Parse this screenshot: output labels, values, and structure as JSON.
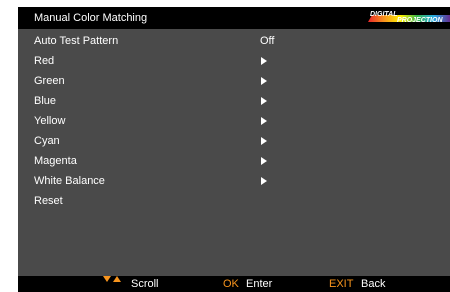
{
  "header": {
    "title": "Manual Color Matching",
    "logo_text": [
      "DIGITAL",
      "PROJECTION"
    ]
  },
  "menu": {
    "items": [
      {
        "label": "Auto Test Pattern",
        "value": "Off"
      },
      {
        "label": "Red",
        "has_submenu": true
      },
      {
        "label": "Green",
        "has_submenu": true
      },
      {
        "label": "Blue",
        "has_submenu": true
      },
      {
        "label": "Yellow",
        "has_submenu": true
      },
      {
        "label": "Cyan",
        "has_submenu": true
      },
      {
        "label": "Magenta",
        "has_submenu": true
      },
      {
        "label": "White Balance",
        "has_submenu": true
      },
      {
        "label": "Reset"
      }
    ]
  },
  "footer": {
    "scroll_label": "Scroll",
    "ok_key": "OK",
    "ok_label": "Enter",
    "exit_key": "EXIT",
    "exit_label": "Back"
  },
  "colors": {
    "panel": "#4a4a4a",
    "bar": "#000000",
    "accent": "#f7941d"
  }
}
